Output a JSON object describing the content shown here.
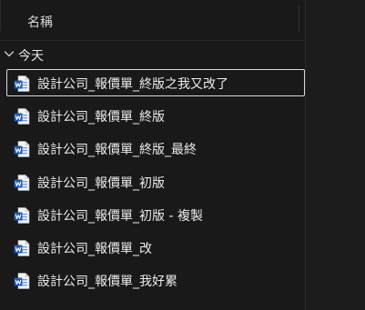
{
  "header": {
    "column_name": "名稱"
  },
  "groups": [
    {
      "label": "今天",
      "expanded": true,
      "files": [
        {
          "name": "設計公司_報價單_終版之我又改了",
          "icon": "word-document-icon",
          "selected": true
        },
        {
          "name": "設計公司_報價單_終版",
          "icon": "word-document-icon",
          "selected": false
        },
        {
          "name": "設計公司_報價單_終版_最終",
          "icon": "word-document-icon",
          "selected": false
        },
        {
          "name": "設計公司_報價單_初版",
          "icon": "word-document-icon",
          "selected": false
        },
        {
          "name": "設計公司_報價單_初版 - 複製",
          "icon": "word-document-icon",
          "selected": false
        },
        {
          "name": "設計公司_報價單_改",
          "icon": "word-document-icon",
          "selected": false
        },
        {
          "name": "設計公司_報價單_我好累",
          "icon": "word-document-icon",
          "selected": false
        }
      ]
    }
  ],
  "colors": {
    "background": "#191919",
    "text": "#ececec",
    "selection_border": "#d9d9d9",
    "word_blue": "#185abd"
  }
}
